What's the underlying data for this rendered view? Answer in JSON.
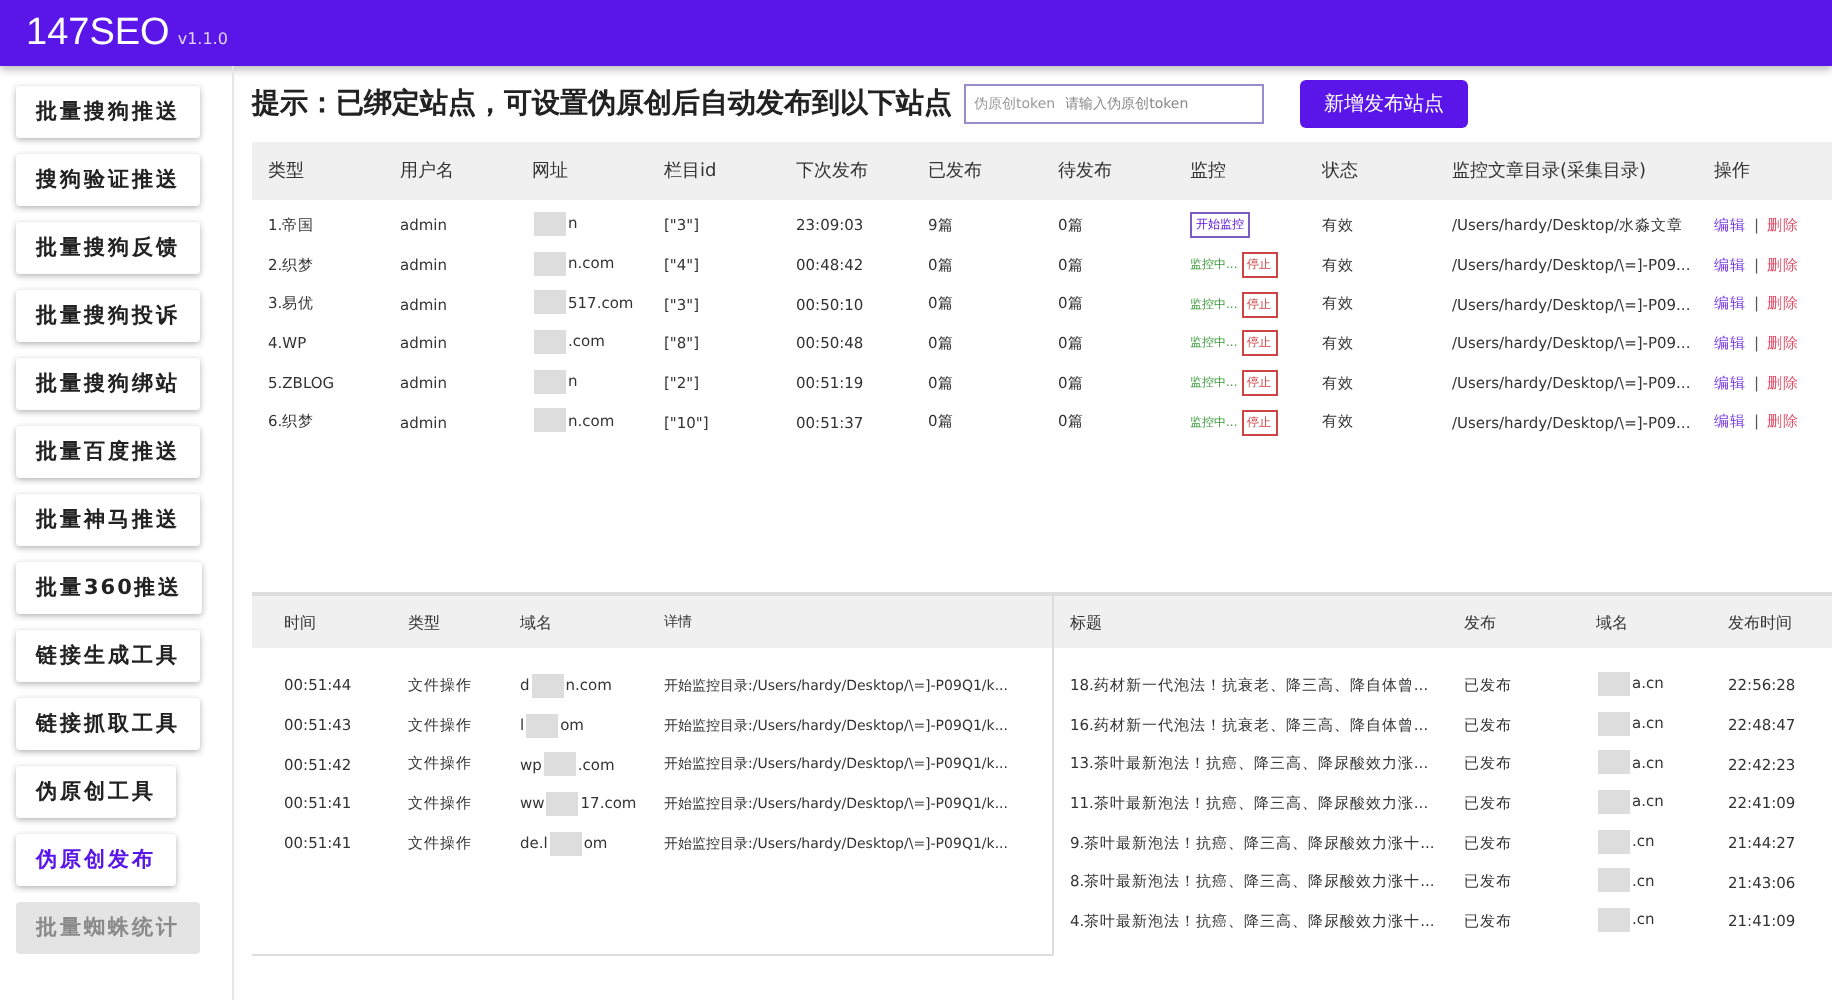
{
  "app": {
    "title": "147SEO",
    "version": "v1.1.0"
  },
  "sidebar": {
    "items": [
      {
        "label": "批量搜狗推送",
        "selected": false,
        "disabled": false
      },
      {
        "label": "搜狗验证推送",
        "selected": false,
        "disabled": false
      },
      {
        "label": "批量搜狗反馈",
        "selected": false,
        "disabled": false
      },
      {
        "label": "批量搜狗投诉",
        "selected": false,
        "disabled": false
      },
      {
        "label": "批量搜狗绑站",
        "selected": false,
        "disabled": false
      },
      {
        "label": "批量百度推送",
        "selected": false,
        "disabled": false
      },
      {
        "label": "批量神马推送",
        "selected": false,
        "disabled": false
      },
      {
        "label": "批量360推送",
        "selected": false,
        "disabled": false
      },
      {
        "label": "链接生成工具",
        "selected": false,
        "disabled": false
      },
      {
        "label": "链接抓取工具",
        "selected": false,
        "disabled": false
      },
      {
        "label": "伪原创工具",
        "selected": false,
        "disabled": false
      },
      {
        "label": "伪原创发布",
        "selected": true,
        "disabled": false
      },
      {
        "label": "批量蜘蛛统计",
        "selected": false,
        "disabled": true
      }
    ]
  },
  "hint": "提示：已绑定站点，可设置伪原创后自动发布到以下站点",
  "token_field": {
    "label": "伪原创token",
    "placeholder": "请输入伪原创token"
  },
  "add_button": "新增发布站点",
  "sites": {
    "columns": [
      "类型",
      "用户名",
      "网址",
      "栏目id",
      "下次发布",
      "已发布",
      "待发布",
      "监控",
      "状态",
      "监控文章目录(采集目录)",
      "操作"
    ],
    "rows": [
      {
        "type": "1.帝国",
        "user": "admin",
        "url_prefix": "",
        "url_suffix": "n",
        "column_id": "[\"3\"]",
        "next": "23:09:03",
        "published": "9篇",
        "pending": "0篇",
        "monitor": {
          "kind": "start",
          "label": "开始监控"
        },
        "status": "有效",
        "dir": "/Users/hardy/Desktop/水淼文章",
        "edit": "编辑",
        "sep": "|",
        "delete": "删除"
      },
      {
        "type": "2.织梦",
        "user": "admin",
        "url_prefix": "",
        "url_suffix": "n.com",
        "column_id": "[\"4\"]",
        "next": "00:48:42",
        "published": "0篇",
        "pending": "0篇",
        "monitor": {
          "kind": "running",
          "label": "监控中...",
          "stop": "停止"
        },
        "status": "有效",
        "dir": "/Users/hardy/Desktop/\\=]-P09...",
        "edit": "编辑",
        "sep": "|",
        "delete": "删除"
      },
      {
        "type": "3.易优",
        "user": "admin",
        "url_prefix": "",
        "url_suffix": "517.com",
        "column_id": "[\"3\"]",
        "next": "00:50:10",
        "published": "0篇",
        "pending": "0篇",
        "monitor": {
          "kind": "running",
          "label": "监控中...",
          "stop": "停止"
        },
        "status": "有效",
        "dir": "/Users/hardy/Desktop/\\=]-P09...",
        "edit": "编辑",
        "sep": "|",
        "delete": "删除"
      },
      {
        "type": "4.WP",
        "user": "admin",
        "url_prefix": "",
        "url_suffix": ".com",
        "column_id": "[\"8\"]",
        "next": "00:50:48",
        "published": "0篇",
        "pending": "0篇",
        "monitor": {
          "kind": "running",
          "label": "监控中...",
          "stop": "停止"
        },
        "status": "有效",
        "dir": "/Users/hardy/Desktop/\\=]-P09...",
        "edit": "编辑",
        "sep": "|",
        "delete": "删除"
      },
      {
        "type": "5.ZBLOG",
        "user": "admin",
        "url_prefix": "",
        "url_suffix": "n",
        "column_id": "[\"2\"]",
        "next": "00:51:19",
        "published": "0篇",
        "pending": "0篇",
        "monitor": {
          "kind": "running",
          "label": "监控中...",
          "stop": "停止"
        },
        "status": "有效",
        "dir": "/Users/hardy/Desktop/\\=]-P09...",
        "edit": "编辑",
        "sep": "|",
        "delete": "删除"
      },
      {
        "type": "6.织梦",
        "user": "admin",
        "url_prefix": "",
        "url_suffix": "n.com",
        "column_id": "[\"10\"]",
        "next": "00:51:37",
        "published": "0篇",
        "pending": "0篇",
        "monitor": {
          "kind": "running",
          "label": "监控中...",
          "stop": "停止"
        },
        "status": "有效",
        "dir": "/Users/hardy/Desktop/\\=]-P09...",
        "edit": "编辑",
        "sep": "|",
        "delete": "删除"
      }
    ]
  },
  "log": {
    "columns": [
      "时间",
      "类型",
      "域名",
      "详情"
    ],
    "rows": [
      {
        "time": "00:51:44",
        "type": "文件操作",
        "domain_prefix": "d",
        "domain_suffix": "n.com",
        "detail": "开始监控目录:/Users/hardy/Desktop/\\=]-P09Q1/k..."
      },
      {
        "time": "00:51:43",
        "type": "文件操作",
        "domain_prefix": "l",
        "domain_suffix": "om",
        "detail": "开始监控目录:/Users/hardy/Desktop/\\=]-P09Q1/k..."
      },
      {
        "time": "00:51:42",
        "type": "文件操作",
        "domain_prefix": "wp",
        "domain_suffix": ".com",
        "detail": "开始监控目录:/Users/hardy/Desktop/\\=]-P09Q1/k..."
      },
      {
        "time": "00:51:41",
        "type": "文件操作",
        "domain_prefix": "ww",
        "domain_suffix": "17.com",
        "detail": "开始监控目录:/Users/hardy/Desktop/\\=]-P09Q1/k..."
      },
      {
        "time": "00:51:41",
        "type": "文件操作",
        "domain_prefix": "de.l",
        "domain_suffix": "om",
        "detail": "开始监控目录:/Users/hardy/Desktop/\\=]-P09Q1/k..."
      }
    ]
  },
  "articles": {
    "columns": [
      "标题",
      "发布",
      "域名",
      "发布时间"
    ],
    "rows": [
      {
        "title": "18.药材新一代泡法！抗衰老、降三高、降自体曾...",
        "state": "已发布",
        "domain_suffix": "a.cn",
        "time": "22:56:28"
      },
      {
        "title": "16.药材新一代泡法！抗衰老、降三高、降自体曾...",
        "state": "已发布",
        "domain_suffix": "a.cn",
        "time": "22:48:47"
      },
      {
        "title": "13.茶叶最新泡法！抗癌、降三高、降尿酸效力涨...",
        "state": "已发布",
        "domain_suffix": "a.cn",
        "time": "22:42:23"
      },
      {
        "title": "11.茶叶最新泡法！抗癌、降三高、降尿酸效力涨...",
        "state": "已发布",
        "domain_suffix": "a.cn",
        "time": "22:41:09"
      },
      {
        "title": "9.茶叶最新泡法！抗癌、降三高、降尿酸效力涨十...",
        "state": "已发布",
        "domain_suffix": ".cn",
        "time": "21:44:27"
      },
      {
        "title": "8.茶叶最新泡法！抗癌、降三高、降尿酸效力涨十...",
        "state": "已发布",
        "domain_suffix": ".cn",
        "time": "21:43:06"
      },
      {
        "title": "4.茶叶最新泡法！抗癌、降三高、降尿酸效力涨十...",
        "state": "已发布",
        "domain_suffix": ".cn",
        "time": "21:41:09"
      }
    ]
  }
}
